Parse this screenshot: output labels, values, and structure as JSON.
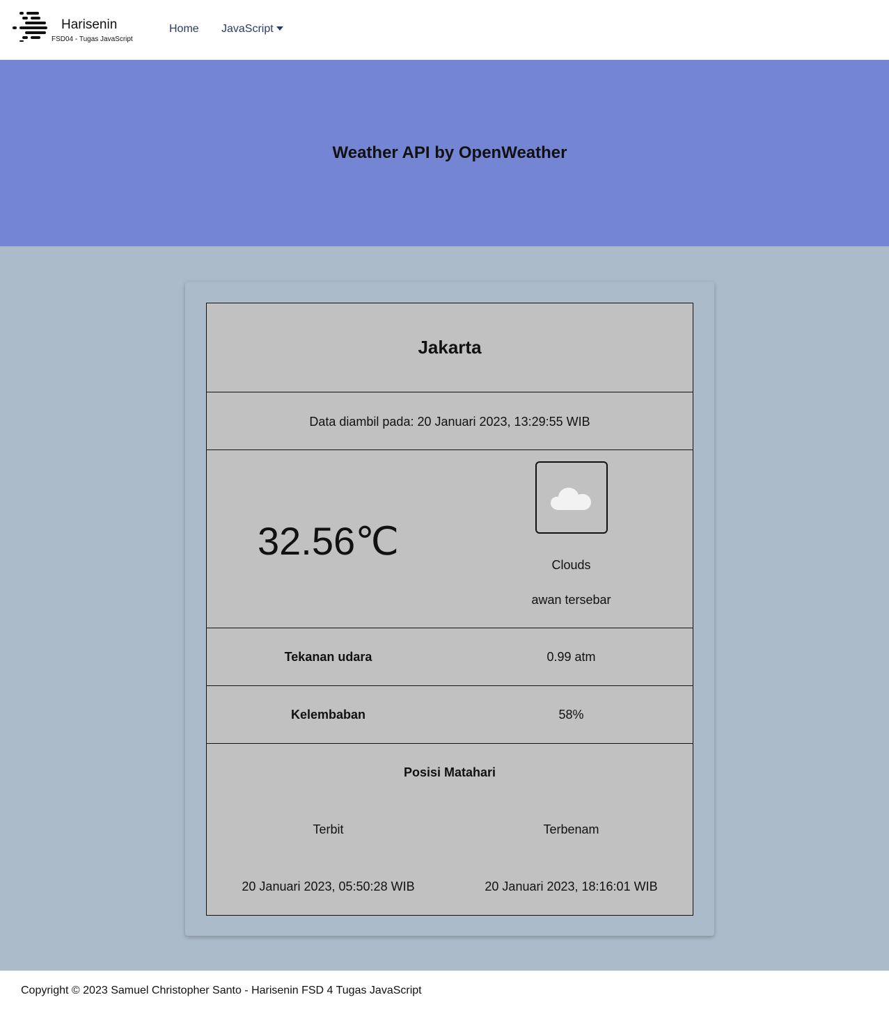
{
  "navbar": {
    "brand_name": "Harisenin",
    "brand_subtitle": "FSD04 - Tugas JavaScript",
    "links": {
      "home": "Home",
      "javascript": "JavaScript"
    },
    "link_color": "#2a3a6b"
  },
  "hero": {
    "title": "Weather API by OpenWeather",
    "background": "#7485d4"
  },
  "weather": {
    "city": "Jakarta",
    "fetched_at": "Data diambil pada: 20 Januari 2023, 13:29:55 WIB",
    "temperature": "32.56℃",
    "condition_icon": "cloud-icon",
    "condition_main": "Clouds",
    "condition_description": "awan tersebar",
    "pressure_label": "Tekanan udara",
    "pressure_value": "0.99 atm",
    "humidity_label": "Kelembaban",
    "humidity_value": "58%",
    "sun": {
      "title": "Posisi Matahari",
      "sunrise_label": "Terbit",
      "sunset_label": "Terbenam",
      "sunrise_time": "20 Januari 2023, 05:50:28 WIB",
      "sunset_time": "20 Januari 2023, 18:16:01 WIB"
    },
    "table_background": "#c1c1c1",
    "page_background": "#acbbc9"
  },
  "footer": {
    "text": "Copyright © 2023 Samuel Christopher Santo - Harisenin FSD 4 Tugas JavaScript"
  }
}
